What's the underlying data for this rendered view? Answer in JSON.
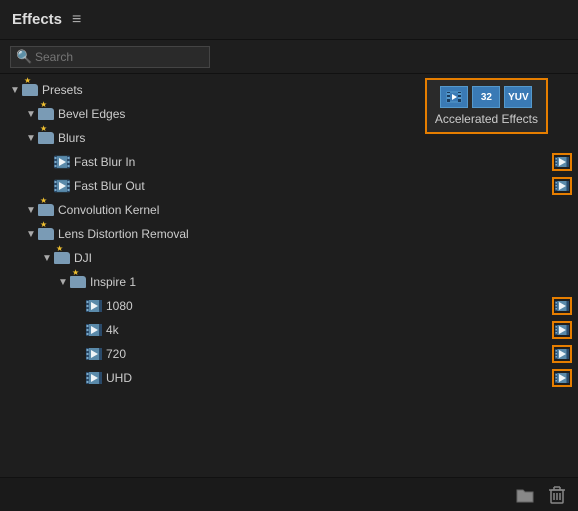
{
  "panel": {
    "title": "Effects",
    "hamburger": "≡"
  },
  "search": {
    "placeholder": "Search"
  },
  "accel": {
    "label": "Accelerated Effects",
    "btn1": "▶",
    "btn2": "32",
    "btn3": "YUV"
  },
  "tree": [
    {
      "id": "presets",
      "label": "Presets",
      "indent": 1,
      "type": "star-folder",
      "chevron": "▼",
      "accel": false
    },
    {
      "id": "bevel-edges",
      "label": "Bevel Edges",
      "indent": 2,
      "type": "star-folder",
      "chevron": "▼",
      "accel": false
    },
    {
      "id": "blurs",
      "label": "Blurs",
      "indent": 2,
      "type": "star-folder",
      "chevron": "▼",
      "accel": false
    },
    {
      "id": "fast-blur-in",
      "label": "Fast Blur In",
      "indent": 3,
      "type": "effect",
      "chevron": "",
      "accel": true
    },
    {
      "id": "fast-blur-out",
      "label": "Fast Blur Out",
      "indent": 3,
      "type": "effect",
      "chevron": "",
      "accel": true
    },
    {
      "id": "convolution-kernel",
      "label": "Convolution Kernel",
      "indent": 2,
      "type": "star-folder",
      "chevron": "▼",
      "accel": false
    },
    {
      "id": "lens-distortion",
      "label": "Lens Distortion Removal",
      "indent": 2,
      "type": "star-folder",
      "chevron": "▼",
      "accel": false
    },
    {
      "id": "dji",
      "label": "DJI",
      "indent": 3,
      "type": "star-folder",
      "chevron": "▼",
      "accel": false
    },
    {
      "id": "inspire1",
      "label": "Inspire 1",
      "indent": 4,
      "type": "star-folder",
      "chevron": "▼",
      "accel": false
    },
    {
      "id": "1080",
      "label": "1080",
      "indent": 5,
      "type": "effect",
      "chevron": "",
      "accel": true
    },
    {
      "id": "4k",
      "label": "4k",
      "indent": 5,
      "type": "effect",
      "chevron": "",
      "accel": true
    },
    {
      "id": "720",
      "label": "720",
      "indent": 5,
      "type": "effect",
      "chevron": "",
      "accel": true
    },
    {
      "id": "uhd",
      "label": "UHD",
      "indent": 5,
      "type": "effect",
      "chevron": "",
      "accel": true
    }
  ],
  "toolbar": {
    "folder_icon": "📁",
    "trash_icon": "🗑"
  }
}
